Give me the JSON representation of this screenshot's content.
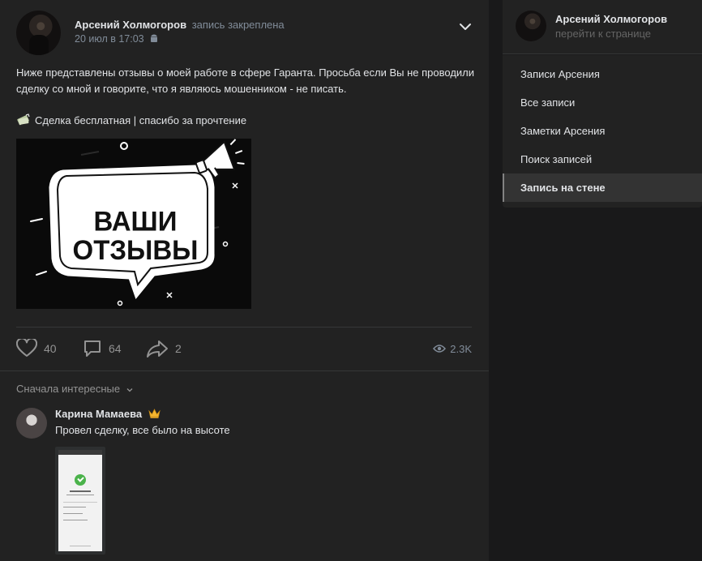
{
  "post": {
    "author_name": "Арсений Холмогоров",
    "pinned_label": "запись закреплена",
    "date": "20 июл в 17:03",
    "text": "Ниже представлены отзывы о моей работе в сфере Гаранта. Просьба если Вы не проводили сделку со мной и говорите, что я являюсь мошенником - не писать.",
    "deal_line": "Сделка бесплатная | спасибо за прочтение",
    "image_text_line1": "ВАШИ",
    "image_text_line2": "ОТЗЫВЫ",
    "likes": "40",
    "comments": "64",
    "shares": "2",
    "views": "2.3K"
  },
  "comments": {
    "sort_label": "Сначала интересные",
    "items": [
      {
        "author": "Карина Мамаева",
        "text": "Провел сделку, все было на высоте"
      }
    ]
  },
  "sidebar": {
    "profile_name": "Арсений Холмогоров",
    "profile_link": "перейти к странице",
    "menu": [
      {
        "label": "Записи Арсения"
      },
      {
        "label": "Все записи"
      },
      {
        "label": "Заметки Арсения"
      },
      {
        "label": "Поиск записей"
      },
      {
        "label": "Запись на стене",
        "active": true
      }
    ]
  },
  "icons": {
    "chevron": "chevron-down-icon",
    "like": "heart-icon",
    "comment": "comment-icon",
    "share": "share-arrow-icon",
    "views": "eye-icon",
    "platform": "android-icon",
    "deal_emoji": "money-emoji-icon",
    "crown": "crown-emoji-icon"
  },
  "colors": {
    "background": "#19191a",
    "card": "#222222",
    "text": "#e1e3e6",
    "secondary": "#818c99",
    "divider": "#363738"
  }
}
